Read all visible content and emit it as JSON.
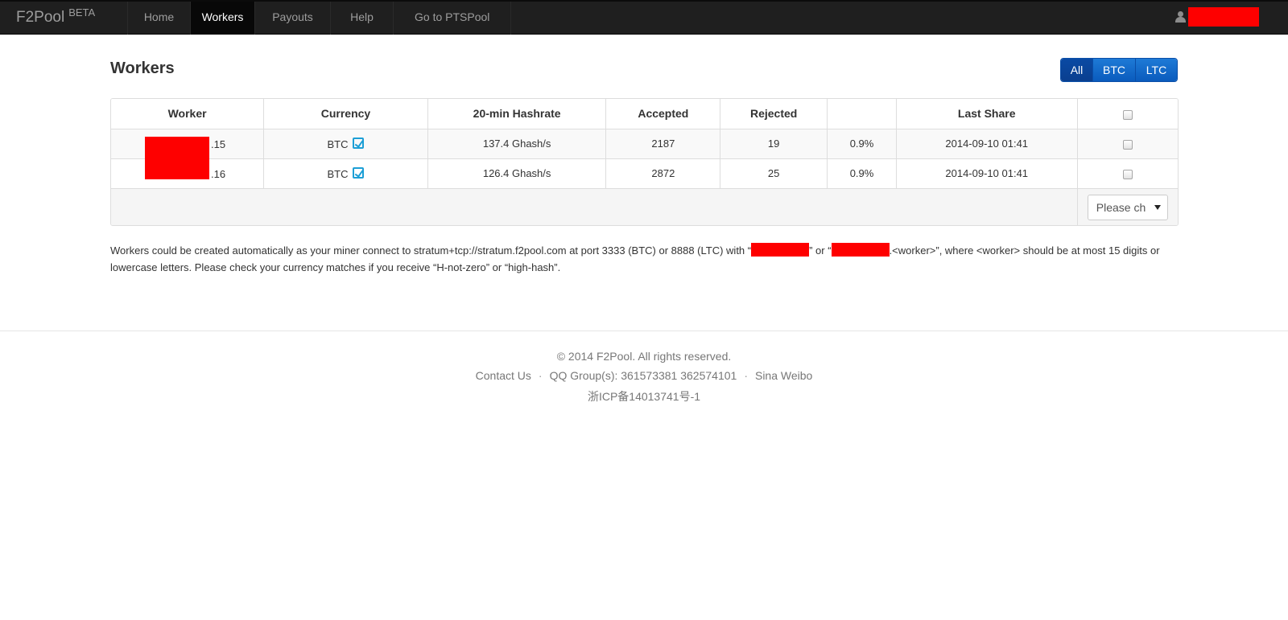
{
  "navbar": {
    "brand": "F2Pool",
    "beta": "BETA",
    "items": [
      {
        "label": "Home"
      },
      {
        "label": "Workers"
      },
      {
        "label": "Payouts"
      },
      {
        "label": "Help"
      },
      {
        "label": "Go to PTSPool"
      }
    ],
    "active": "Workers"
  },
  "page": {
    "title": "Workers",
    "filter": [
      "All",
      "BTC",
      "LTC"
    ],
    "filter_active": "All"
  },
  "table": {
    "headers": [
      "Worker",
      "Currency",
      "20-min Hashrate",
      "Accepted",
      "Rejected",
      "",
      "Last Share"
    ],
    "rows": [
      {
        "worker_suffix": ".15",
        "currency": "BTC",
        "hashrate": "137.4 Ghash/s",
        "accepted": "2187",
        "rejected": "19",
        "reject_rate": "0.9%",
        "last_share": "2014-09-10 01:41"
      },
      {
        "worker_suffix": ".16",
        "currency": "BTC",
        "hashrate": "126.4 Ghash/s",
        "accepted": "2872",
        "rejected": "25",
        "reject_rate": "0.9%",
        "last_share": "2014-09-10 01:41"
      }
    ],
    "action_select": "Please ch"
  },
  "info": {
    "part1": "Workers could be created automatically as your miner connect to stratum+tcp://stratum.f2pool.com at port 3333 (BTC) or 8888 (LTC) with “",
    "part2": "” or “",
    "part3": ".<worker>”, where <worker> should be at most 15 digits or lowercase letters. Please check your currency matches if you receive “H-not-zero” or “high-hash”."
  },
  "footer": {
    "copyright": "© 2014 F2Pool. All rights reserved.",
    "contact": "Contact Us",
    "qq": "QQ Group(s): 361573381 362574101",
    "weibo": "Sina Weibo",
    "icp": "浙ICP备14013741号-1"
  },
  "colors": {
    "navbar_bg": "#1f1f1f",
    "accent": "#0a5bbd",
    "redaction": "#fe0000",
    "edit_icon": "#1d9fd6"
  }
}
